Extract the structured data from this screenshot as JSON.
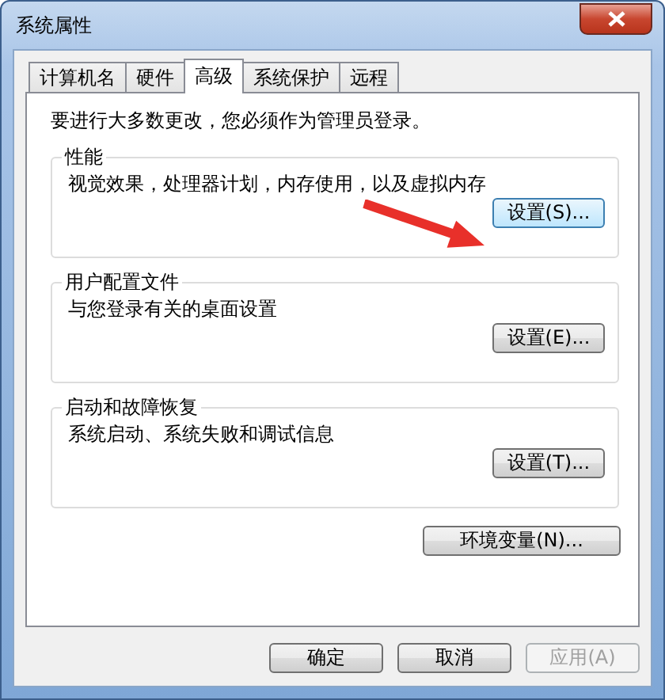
{
  "window": {
    "title": "系统属性"
  },
  "tabs": [
    {
      "label": "计算机名",
      "selected": false
    },
    {
      "label": "硬件",
      "selected": false
    },
    {
      "label": "高级",
      "selected": true
    },
    {
      "label": "系统保护",
      "selected": false
    },
    {
      "label": "远程",
      "selected": false
    }
  ],
  "notice": "要进行大多数更改，您必须作为管理员登录。",
  "groups": [
    {
      "title": "性能",
      "description": "视觉效果，处理器计划，内存使用，以及虚拟内存",
      "button": {
        "label": "设置(S)...",
        "highlighted": true
      }
    },
    {
      "title": "用户配置文件",
      "description": "与您登录有关的桌面设置",
      "button": {
        "label": "设置(E)...",
        "highlighted": false
      }
    },
    {
      "title": "启动和故障恢复",
      "description": "系统启动、系统失败和调试信息",
      "button": {
        "label": "设置(T)...",
        "highlighted": false
      }
    }
  ],
  "environment_button": {
    "label": "环境变量(N)..."
  },
  "footer_buttons": [
    {
      "label": "确定",
      "disabled": false
    },
    {
      "label": "取消",
      "disabled": false
    },
    {
      "label": "应用(A)",
      "disabled": true
    }
  ]
}
